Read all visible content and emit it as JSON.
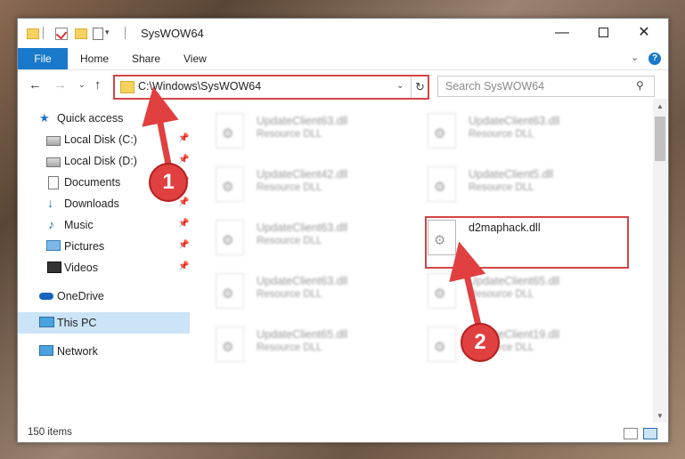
{
  "window": {
    "title": "SysWOW64",
    "minimize_label": "—",
    "close_label": "✕"
  },
  "ribbon": {
    "tabs": [
      "File",
      "Home",
      "Share",
      "View"
    ],
    "help_label": "?"
  },
  "address_bar": {
    "path": "C:\\Windows\\SysWOW64",
    "refresh_glyph": "↻"
  },
  "search": {
    "placeholder": "Search SysWOW64",
    "icon": "search-icon"
  },
  "nav": {
    "back": "←",
    "forward": "→",
    "up": "↑"
  },
  "sidebar": {
    "items": [
      {
        "label": "Quick access",
        "icon": "star-icon",
        "pinned": false
      },
      {
        "label": "Local Disk (C:)",
        "icon": "disk-icon",
        "pinned": true
      },
      {
        "label": "Local Disk (D:)",
        "icon": "disk-icon",
        "pinned": true
      },
      {
        "label": "Documents",
        "icon": "document-icon",
        "pinned": true
      },
      {
        "label": "Downloads",
        "icon": "download-icon",
        "pinned": true
      },
      {
        "label": "Music",
        "icon": "music-icon",
        "pinned": true
      },
      {
        "label": "Pictures",
        "icon": "pictures-icon",
        "pinned": true
      },
      {
        "label": "Videos",
        "icon": "videos-icon",
        "pinned": true
      },
      {
        "label": "OneDrive",
        "icon": "onedrive-icon",
        "pinned": false
      },
      {
        "label": "This PC",
        "icon": "computer-icon",
        "pinned": false,
        "selected": true
      },
      {
        "label": "Network",
        "icon": "network-icon",
        "pinned": false
      }
    ]
  },
  "files": [
    {
      "name": "UpdateClient63.dll",
      "type": "Resource DLL",
      "blurred": true
    },
    {
      "name": "UpdateClient63.dll",
      "type": "Resource DLL",
      "blurred": true
    },
    {
      "name": "UpdateClient42.dll",
      "type": "Resource DLL",
      "blurred": true
    },
    {
      "name": "UpdateClient5.dll",
      "type": "Resource DLL",
      "blurred": true
    },
    {
      "name": "UpdateClient63.dll",
      "type": "Resource DLL",
      "blurred": true
    },
    {
      "name": "d2maphack.dll",
      "type": "",
      "blurred": false,
      "highlighted": true
    },
    {
      "name": "UpdateClient63.dll",
      "type": "Resource DLL",
      "blurred": true
    },
    {
      "name": "UpdateClient65.dll",
      "type": "Resource DLL",
      "blurred": true
    },
    {
      "name": "UpdateClient65.dll",
      "type": "Resource DLL",
      "blurred": true
    },
    {
      "name": "UpdateClient19.dll",
      "type": "Resource DLL",
      "blurred": true
    }
  ],
  "status": {
    "item_count": "150 items"
  },
  "annotations": {
    "step1": "1",
    "step2": "2",
    "color": "#e04040"
  }
}
